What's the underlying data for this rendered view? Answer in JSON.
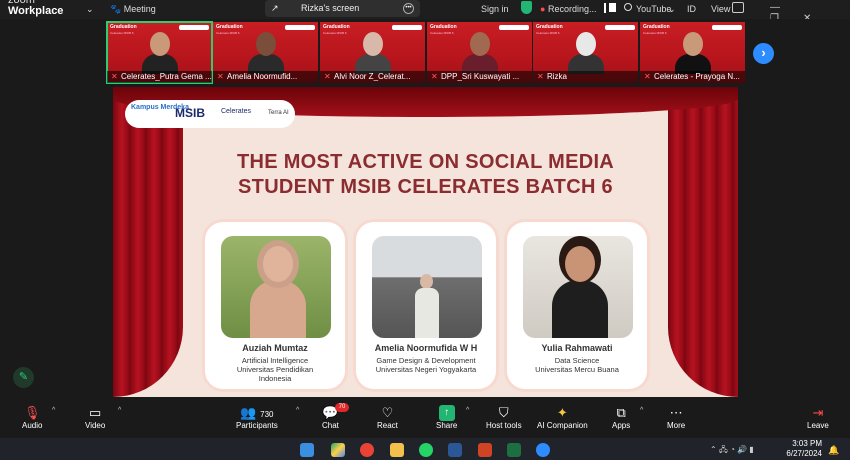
{
  "app": {
    "name_line1": "zoom",
    "name_line2": "Workplace",
    "meeting_label": "Meeting",
    "screen_share_label": "Rizka's screen",
    "sign_in": "Sign in",
    "recording": "Recording...",
    "youtube": "YouTube",
    "id": "ID",
    "view": "View"
  },
  "tile_text": {
    "title": "Graduation",
    "subtitle": "Celerates MSIB 6"
  },
  "participants": [
    {
      "name": "Celerates_Putra Gema ..."
    },
    {
      "name": "Amelia Noormufid..."
    },
    {
      "name": "Alvi Noor Z_Celerat..."
    },
    {
      "name": "DPP_Sri Kuswayati ..."
    },
    {
      "name": "Rizka"
    },
    {
      "name": "Celerates - Prayoga N..."
    }
  ],
  "slide": {
    "logos": {
      "kampus": "Kampus Merdeka",
      "msib": "MSIB",
      "celerates": "Celerates",
      "terra": "Terra AI"
    },
    "title_line1": "THE MOST ACTIVE ON SOCIAL MEDIA",
    "title_line2": "STUDENT MSIB CELERATES BATCH 6",
    "students": [
      {
        "name": "Auziah Mumtaz",
        "role1": "Artificial Intelligence",
        "role2": "Universitas Pendidikan",
        "role3": "Indonesia"
      },
      {
        "name": "Amelia Noormufida W H",
        "role1": "Game Design & Development",
        "role2": "Universitas Negeri Yogyakarta",
        "role3": ""
      },
      {
        "name": "Yulia Rahmawati",
        "role1": "Data Science",
        "role2": "Universitas Mercu Buana",
        "role3": ""
      }
    ]
  },
  "controls": {
    "audio": "Audio",
    "video": "Video",
    "participants": "Participants",
    "participant_count": "730",
    "chat": "Chat",
    "chat_badge": "70",
    "react": "React",
    "share": "Share",
    "host_tools": "Host tools",
    "ai_companion": "AI Companion",
    "apps": "Apps",
    "more": "More",
    "leave": "Leave"
  },
  "taskbar": {
    "time": "3:03 PM",
    "date": "6/27/2024"
  },
  "colors": {
    "brand_blue": "#2d8cff",
    "slide_red": "#b81321",
    "title_color": "#8a2c30",
    "active_green": "#2ecc71"
  }
}
